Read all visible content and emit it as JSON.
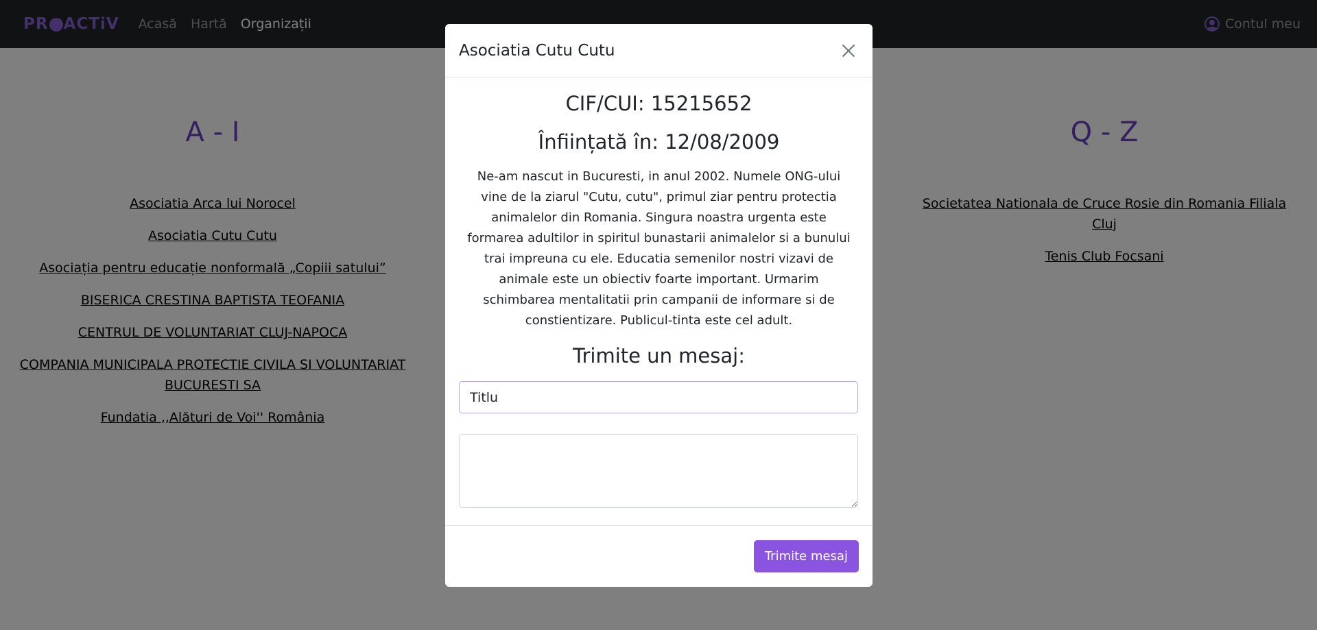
{
  "navbar": {
    "brand_before": "PR",
    "brand_after": "ACTiV",
    "links": [
      "Acasă",
      "Hartă",
      "Organizații"
    ],
    "active_link": "Organizații",
    "account_label": "Contul meu"
  },
  "columns": {
    "left": {
      "heading": "A - I",
      "items": [
        "Asociatia Arca lui Norocel",
        "Asociatia Cutu Cutu",
        "Asociația pentru educație nonformală „Copiii satului”",
        "BISERICA CRESTINA BAPTISTA TEOFANIA",
        "CENTRUL DE VOLUNTARIAT CLUJ-NAPOCA",
        "COMPANIA MUNICIPALA PROTECTIE CIVILA SI VOLUNTARIAT BUCURESTI SA",
        "Fundatia ,,Alături de Voi'' România"
      ]
    },
    "right": {
      "heading": "Q - Z",
      "items": [
        "Societatea Nationala de Cruce Rosie din Romania Filiala Cluj",
        "Tenis Club Focsani"
      ]
    }
  },
  "modal": {
    "title": "Asociatia Cutu Cutu",
    "cif": "CIF/CUI: 15215652",
    "founded": "Înființată în: 12/08/2009",
    "description": "Ne-am nascut in Bucuresti, in anul 2002. Numele ONG-ului vine de la ziarul \"Cutu, cutu\", primul ziar pentru protectia animalelor din Romania. Singura noastra urgenta este formarea adultilor in spiritul bunastarii animalelor si a bunului trai impreuna cu ele. Educatia semenilor nostri vizavi de animale este un obiectiv foarte important. Urmarim schimbarea mentalitatii prin campanii de informare si de constientizare. Publicul-tinta este cel adult.",
    "send_heading": "Trimite un mesaj:",
    "title_input_value": "Titlu",
    "message_value": "",
    "send_button": "Trimite mesaj"
  },
  "colors": {
    "accent": "#8a53e0",
    "heading": "#6a3fc4",
    "navbar": "#212529"
  }
}
